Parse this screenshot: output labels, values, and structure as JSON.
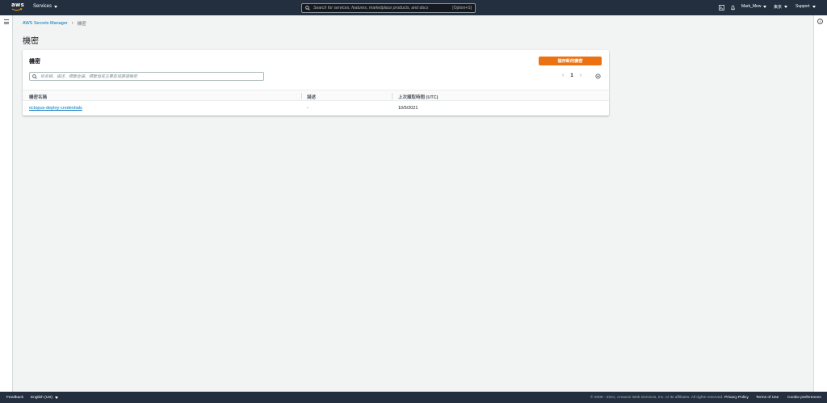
{
  "topnav": {
    "logo_text": "aws",
    "services_label": "Services",
    "search_placeholder": "Search for services, features, marketplace products, and docs",
    "search_shortcut": "[Option+S]",
    "user_label": "Mark_Mew",
    "region_label": "東京",
    "support_label": "Support",
    "icons": [
      "cloudshell-icon",
      "bell-icon"
    ]
  },
  "breadcrumb": {
    "items": [
      "AWS Secrets Manager",
      "機密"
    ]
  },
  "page_title": "機密",
  "panel": {
    "title": "機密",
    "store_button_label": "儲存新的機密",
    "filter_placeholder": "依名稱、描述、標籤金鑰、標籤值或主要區域篩選機密",
    "pagination": {
      "current_page": "1"
    },
    "columns": [
      "機密名稱",
      "描述",
      "上次擷取時間 (UTC)"
    ],
    "rows": [
      {
        "name": "octopus-deploy-credentials",
        "description": "-",
        "last_retrieved": "10/5/2021"
      }
    ]
  },
  "footer": {
    "feedback_label": "Feedback",
    "language_label": "English (US)",
    "copyright": "© 2008 - 2021, Amazon Web Services, Inc. or its affiliates. All rights reserved.",
    "privacy_label": "Privacy Policy",
    "terms_label": "Terms of Use",
    "cookie_label": "Cookie preferences"
  },
  "colors": {
    "nav_bg": "#232f3e",
    "accent_orange": "#ec7211",
    "link_blue": "#0073bb",
    "page_bg": "#f2f3f3"
  }
}
